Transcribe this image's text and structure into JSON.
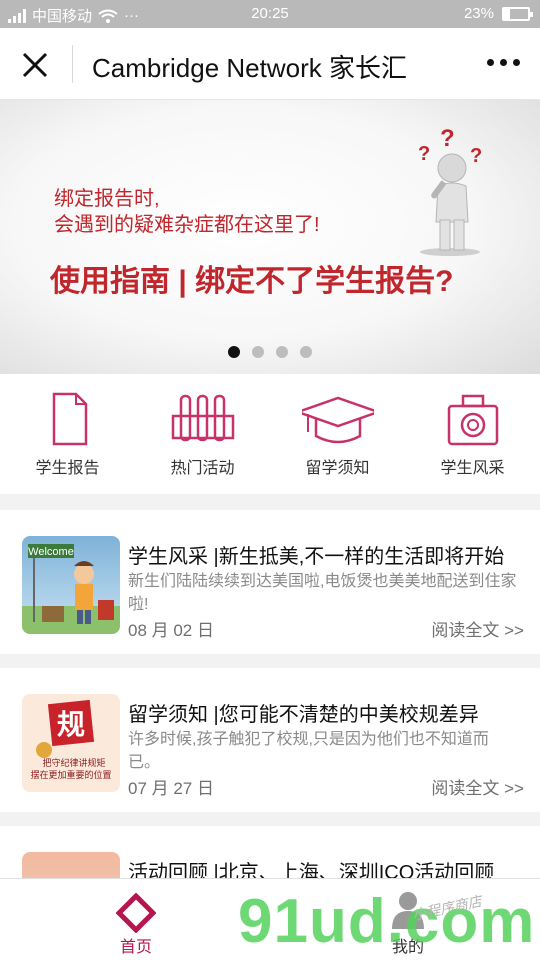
{
  "status_bar": {
    "carrier": "中国移动",
    "time": "20:25",
    "battery": "23%",
    "battery_level": 0.23
  },
  "nav": {
    "title": "Cambridge Network 家长汇"
  },
  "banner": {
    "line1": "绑定报告时,",
    "line2": "会遇到的疑难杂症都在这里了!",
    "headline": "使用指南 | 绑定不了学生报告?",
    "dots": 4,
    "active_dot": 0,
    "accent": "#c0262c"
  },
  "menu": {
    "items": [
      {
        "label": "学生报告",
        "icon": "document-icon"
      },
      {
        "label": "热门活动",
        "icon": "test-tubes-icon"
      },
      {
        "label": "留学须知",
        "icon": "graduation-cap-icon"
      },
      {
        "label": "学生风采",
        "icon": "camera-icon"
      }
    ],
    "icon_color": "#c8326a"
  },
  "articles": [
    {
      "title": "学生风采 |新生抵美,不一样的生活即将开始",
      "desc": "新生们陆陆续续到达美国啦,电饭煲也美美地配送到住家啦!",
      "date": "08 月 02 日",
      "read": "阅读全文 >>",
      "thumb_text": "Welcome"
    },
    {
      "title": "留学须知 |您可能不清楚的中美校规差异",
      "desc": "许多时候,孩子触犯了校规,只是因为他们也不知道而已。",
      "date": "07 月 27 日",
      "read": "阅读全文 >>",
      "thumb_text": "规",
      "thumb_caption1": "把守纪律讲规矩",
      "thumb_caption2": "摆在更加重要的位置"
    },
    {
      "title": "活动回顾 |北京、上海、深圳ICO活动回顾",
      "desc": "",
      "date": "",
      "read": ""
    }
  ],
  "tab_bar": {
    "home": "首页",
    "mine": "我的",
    "active_color": "#b5164f"
  },
  "watermark": {
    "text": "91ud.com",
    "sub": "小程序商店"
  }
}
